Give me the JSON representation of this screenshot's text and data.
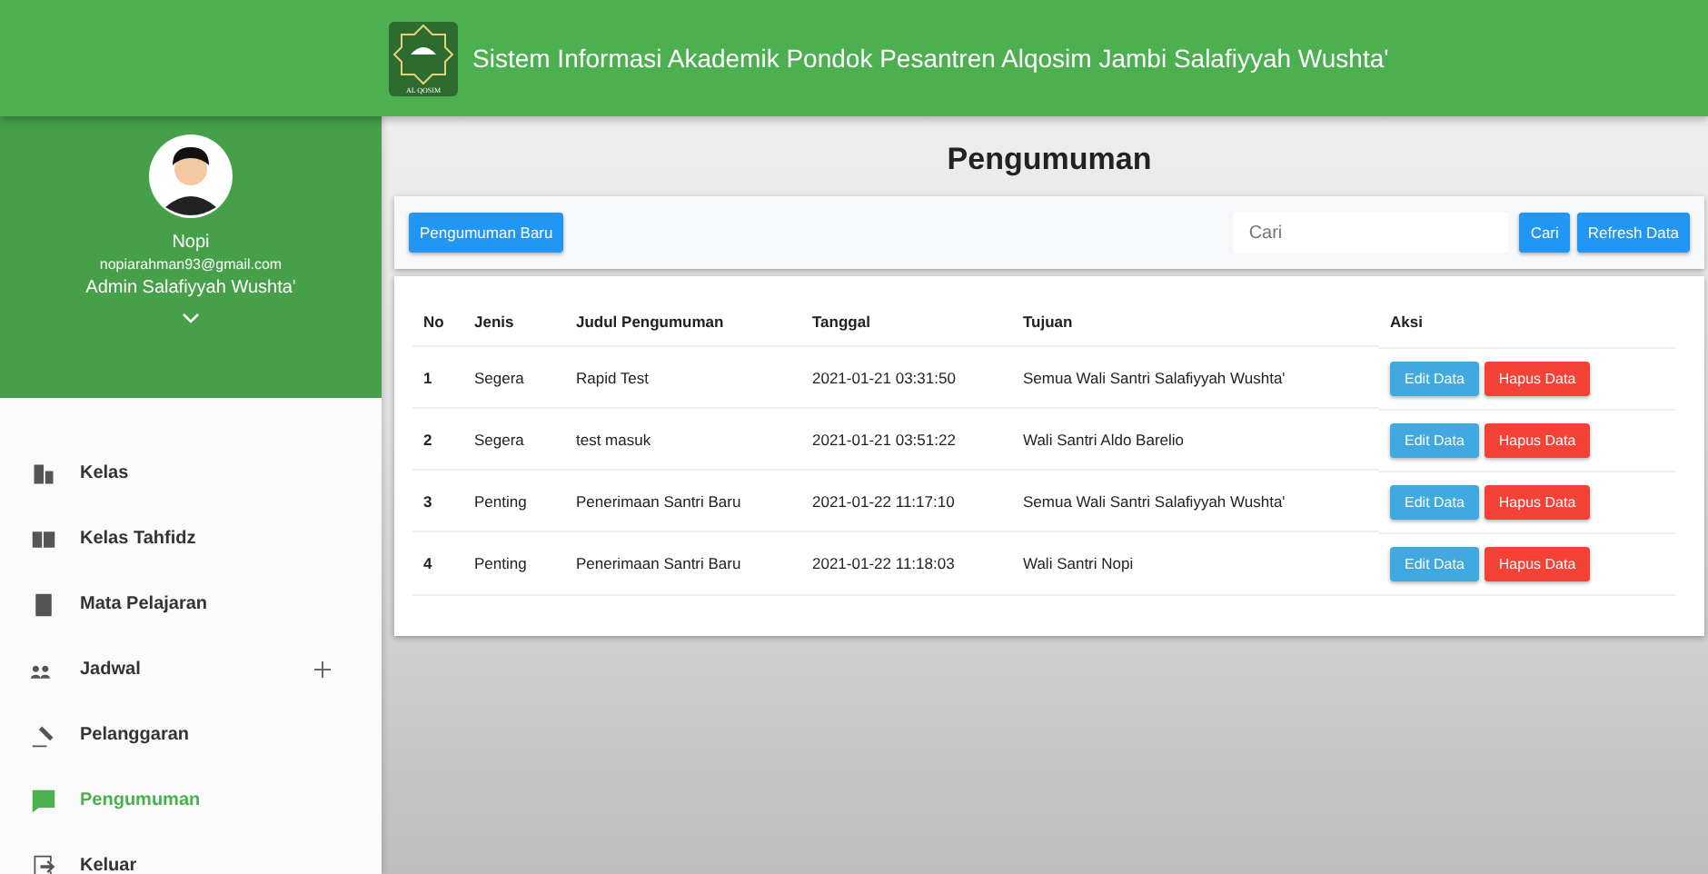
{
  "header": {
    "title": "Sistem Informasi Akademik Pondok Pesantren Alqosim Jambi Salafiyyah Wushta'",
    "logo_text": "AL QOSIM"
  },
  "profile": {
    "name": "Nopi",
    "email": "nopiarahman93@gmail.com",
    "role": "Admin Salafiyyah Wushta'"
  },
  "menu": [
    {
      "label": "Kelas",
      "selected": false,
      "expandable": false
    },
    {
      "label": "Kelas Tahfidz",
      "selected": false,
      "expandable": false
    },
    {
      "label": "Mata Pelajaran",
      "selected": false,
      "expandable": false
    },
    {
      "label": "Jadwal",
      "selected": false,
      "expandable": true
    },
    {
      "label": "Pelanggaran",
      "selected": false,
      "expandable": false
    },
    {
      "label": "Pengumuman",
      "selected": true,
      "expandable": false
    },
    {
      "label": "Keluar",
      "selected": false,
      "expandable": false
    }
  ],
  "page_title": "Pengumuman",
  "toolbar": {
    "new_button": "Pengumuman Baru",
    "search": {
      "placeholder": "Cari"
    },
    "search_button": "Cari",
    "refresh_button": "Refresh Data"
  },
  "table": {
    "columns": [
      "No",
      "Jenis",
      "Judul Pengumuman",
      "Tanggal",
      "Tujuan",
      "Aksi"
    ],
    "rows": [
      {
        "cells": [
          "1",
          "Segera",
          "Rapid Test",
          "2021-01-21 03:31:50",
          "Semua Wali Santri Salafiyyah Wushta'"
        ],
        "actions": [
          "Edit Data",
          "Hapus Data"
        ]
      },
      {
        "cells": [
          "2",
          "Segera",
          "test masuk",
          "2021-01-21 03:51:22",
          "Wali Santri Aldo Barelio"
        ],
        "actions": [
          "Edit Data",
          "Hapus Data"
        ]
      },
      {
        "cells": [
          "3",
          "Penting",
          "Penerimaan Santri Baru",
          "2021-01-22 11:17:10",
          "Semua Wali Santri Salafiyyah Wushta'"
        ],
        "actions": [
          "Edit Data",
          "Hapus Data"
        ]
      },
      {
        "cells": [
          "4",
          "Penting",
          "Penerimaan Santri Baru",
          "2021-01-22 11:18:03",
          "Wali Santri Nopi"
        ],
        "actions": [
          "Edit Data",
          "Hapus Data"
        ]
      }
    ]
  }
}
